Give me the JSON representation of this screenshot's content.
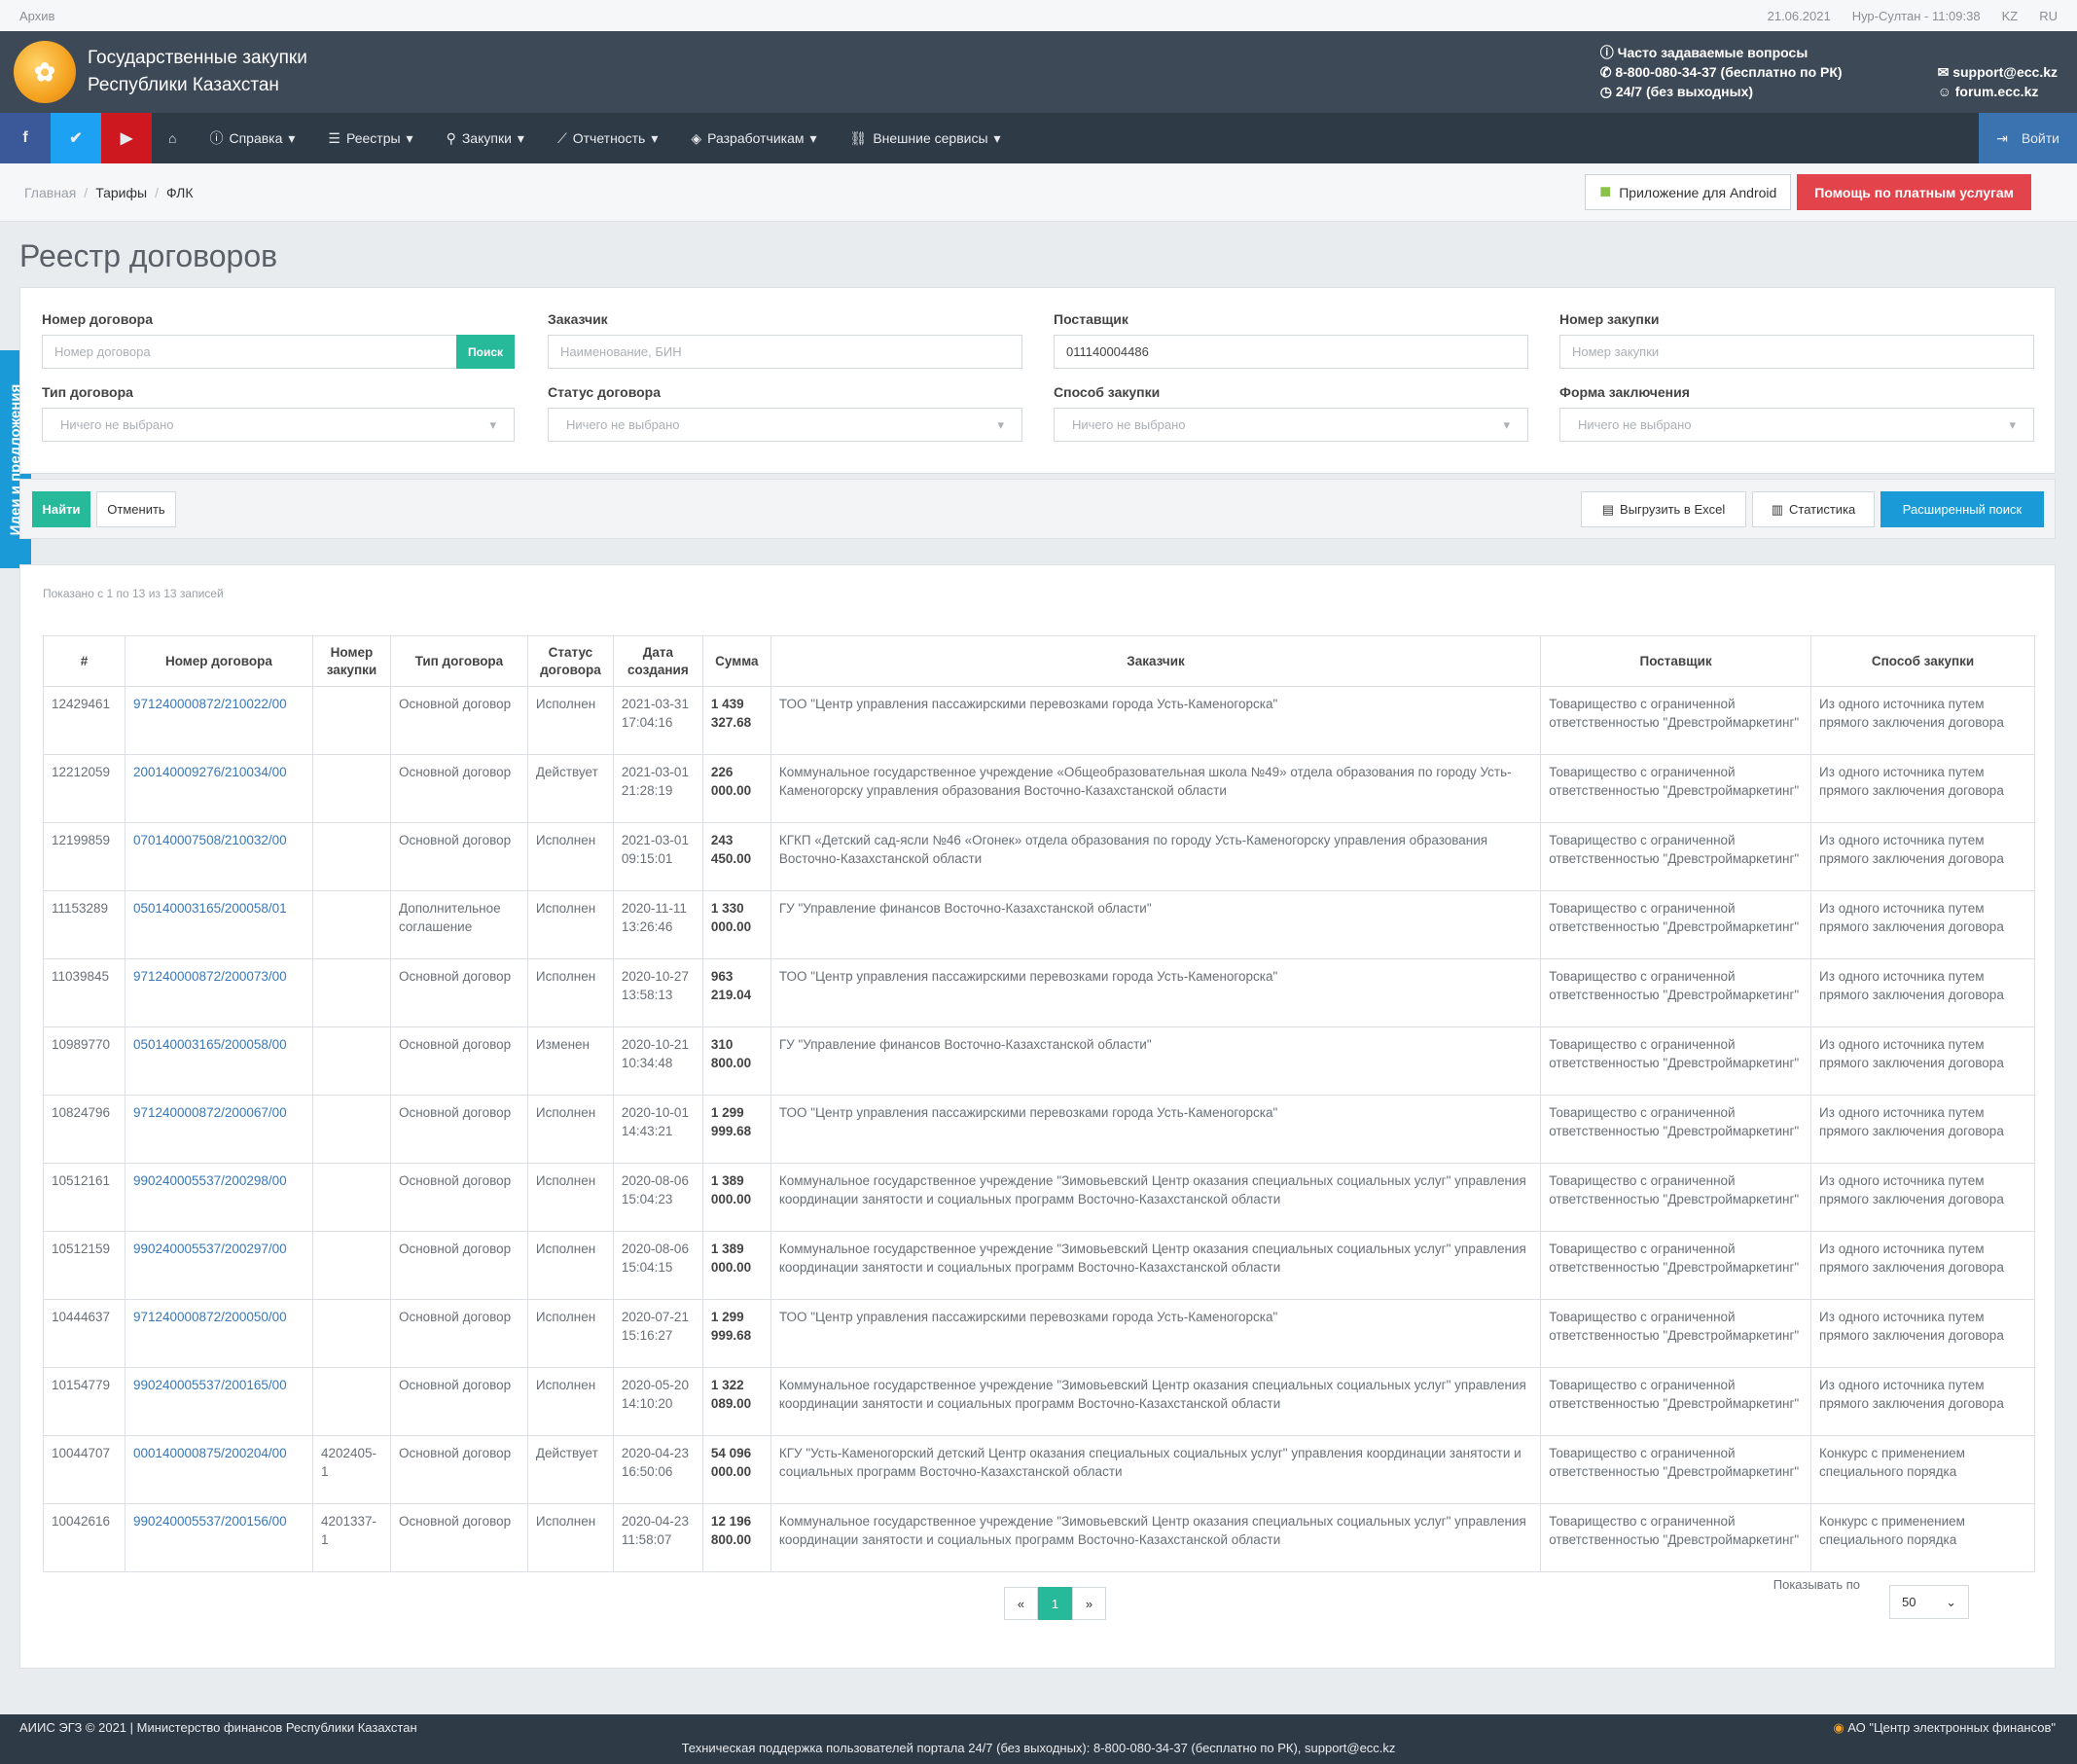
{
  "top_strip": {
    "archive": "Архив",
    "date": "21.06.2021",
    "time": "Нур-Султан - 11:09:38",
    "lang_kz": "KZ",
    "lang_ru": "RU"
  },
  "brand": {
    "line1": "Государственные закупки",
    "line2": "Республики Казахстан",
    "faq": "Часто задаваемые вопросы",
    "phone": "8-800-080-34-37 (бесплатно по РК)",
    "hours": "24/7 (без выходных)",
    "email": "support@ecc.kz",
    "forum": "forum.ecc.kz"
  },
  "nav": {
    "items": [
      "Справка",
      "Реестры",
      "Закупки",
      "Отчетность",
      "Разработчикам",
      "Внешние сервисы"
    ],
    "login": "Войти"
  },
  "breadcrumb": {
    "home": "Главная",
    "tariffs": "Тарифы",
    "current": "ФЛК"
  },
  "header_buttons": {
    "android": "Приложение для Android",
    "help": "Помощь по платным услугам"
  },
  "page_title": "Реестр договоров",
  "side_tab": "Идеи и предложения",
  "filters": {
    "contract_number": {
      "label": "Номер договора",
      "placeholder": "Номер договора",
      "button": "Поиск"
    },
    "customer": {
      "label": "Заказчик",
      "placeholder": "Наименование, БИН"
    },
    "supplier": {
      "label": "Поставщик",
      "value": "011140004486"
    },
    "purchase_number": {
      "label": "Номер закупки",
      "placeholder": "Номер закупки"
    },
    "contract_type": {
      "label": "Тип договора",
      "value": "Ничего не выбрано"
    },
    "contract_status": {
      "label": "Статус договора",
      "value": "Ничего не выбрано"
    },
    "purchase_method": {
      "label": "Способ закупки",
      "value": "Ничего не выбрано"
    },
    "form": {
      "label": "Форма заключения",
      "value": "Ничего не выбрано"
    }
  },
  "actions": {
    "find": "Найти",
    "cancel": "Отменить",
    "excel": "Выгрузить в Excel",
    "stats": "Статистика",
    "advanced": "Расширенный поиск"
  },
  "results_info": "Показано с 1 по 13 из 13 записей",
  "table": {
    "headers": [
      "#",
      "Номер договора",
      "Номер закупки",
      "Тип договора",
      "Статус договора",
      "Дата создания",
      "Сумма",
      "Заказчик",
      "Поставщик",
      "Способ закупки"
    ],
    "rows": [
      {
        "id": "12429461",
        "num": "971240000872/210022/00",
        "purchase": "",
        "type": "Основной договор",
        "status": "Исполнен",
        "date": "2021-03-31 17:04:16",
        "sum": "1 439 327.68",
        "customer": "ТОО \"Центр управления пассажирскими перевозками города Усть-Каменогорска\"",
        "supplier": "Товарищество с ограниченной ответственностью \"Древстроймаркетинг\"",
        "method": "Из одного источника путем прямого заключения договора"
      },
      {
        "id": "12212059",
        "num": "200140009276/210034/00",
        "purchase": "",
        "type": "Основной договор",
        "status": "Действует",
        "date": "2021-03-01 21:28:19",
        "sum": "226 000.00",
        "customer": "Коммунальное государственное учреждение «Общеобразовательная школа №49» отдела образования по городу Усть-Каменогорску управления образования Восточно-Казахстанской области",
        "supplier": "Товарищество с ограниченной ответственностью \"Древстроймаркетинг\"",
        "method": "Из одного источника путем прямого заключения договора"
      },
      {
        "id": "12199859",
        "num": "070140007508/210032/00",
        "purchase": "",
        "type": "Основной договор",
        "status": "Исполнен",
        "date": "2021-03-01 09:15:01",
        "sum": "243 450.00",
        "customer": "КГКП «Детский сад-ясли №46 «Огонек» отдела образования по городу Усть-Каменогорску управления образования Восточно-Казахстанской области",
        "supplier": "Товарищество с ограниченной ответственностью \"Древстроймаркетинг\"",
        "method": "Из одного источника путем прямого заключения договора"
      },
      {
        "id": "11153289",
        "num": "050140003165/200058/01",
        "purchase": "",
        "type": "Дополнительное соглашение",
        "status": "Исполнен",
        "date": "2020-11-11 13:26:46",
        "sum": "1 330 000.00",
        "customer": "ГУ \"Управление финансов Восточно-Казахстанской области\"",
        "supplier": "Товарищество с ограниченной ответственностью \"Древстроймаркетинг\"",
        "method": "Из одного источника путем прямого заключения договора"
      },
      {
        "id": "11039845",
        "num": "971240000872/200073/00",
        "purchase": "",
        "type": "Основной договор",
        "status": "Исполнен",
        "date": "2020-10-27 13:58:13",
        "sum": "963 219.04",
        "customer": "ТОО \"Центр управления пассажирскими перевозками города Усть-Каменогорска\"",
        "supplier": "Товарищество с ограниченной ответственностью \"Древстроймаркетинг\"",
        "method": "Из одного источника путем прямого заключения договора"
      },
      {
        "id": "10989770",
        "num": "050140003165/200058/00",
        "purchase": "",
        "type": "Основной договор",
        "status": "Изменен",
        "date": "2020-10-21 10:34:48",
        "sum": "310 800.00",
        "customer": "ГУ \"Управление финансов Восточно-Казахстанской области\"",
        "supplier": "Товарищество с ограниченной ответственностью \"Древстроймаркетинг\"",
        "method": "Из одного источника путем прямого заключения договора"
      },
      {
        "id": "10824796",
        "num": "971240000872/200067/00",
        "purchase": "",
        "type": "Основной договор",
        "status": "Исполнен",
        "date": "2020-10-01 14:43:21",
        "sum": "1 299 999.68",
        "customer": "ТОО \"Центр управления пассажирскими перевозками города Усть-Каменогорска\"",
        "supplier": "Товарищество с ограниченной ответственностью \"Древстроймаркетинг\"",
        "method": "Из одного источника путем прямого заключения договора"
      },
      {
        "id": "10512161",
        "num": "990240005537/200298/00",
        "purchase": "",
        "type": "Основной договор",
        "status": "Исполнен",
        "date": "2020-08-06 15:04:23",
        "sum": "1 389 000.00",
        "customer": "Коммунальное государственное учреждение \"Зимовьевский Центр оказания специальных социальных услуг\" управления координации занятости и социальных программ Восточно-Казахстанской области",
        "supplier": "Товарищество с ограниченной ответственностью \"Древстроймаркетинг\"",
        "method": "Из одного источника путем прямого заключения договора"
      },
      {
        "id": "10512159",
        "num": "990240005537/200297/00",
        "purchase": "",
        "type": "Основной договор",
        "status": "Исполнен",
        "date": "2020-08-06 15:04:15",
        "sum": "1 389 000.00",
        "customer": "Коммунальное государственное учреждение \"Зимовьевский Центр оказания специальных социальных услуг\" управления координации занятости и социальных программ Восточно-Казахстанской области",
        "supplier": "Товарищество с ограниченной ответственностью \"Древстроймаркетинг\"",
        "method": "Из одного источника путем прямого заключения договора"
      },
      {
        "id": "10444637",
        "num": "971240000872/200050/00",
        "purchase": "",
        "type": "Основной договор",
        "status": "Исполнен",
        "date": "2020-07-21 15:16:27",
        "sum": "1 299 999.68",
        "customer": "ТОО \"Центр управления пассажирскими перевозками города Усть-Каменогорска\"",
        "supplier": "Товарищество с ограниченной ответственностью \"Древстроймаркетинг\"",
        "method": "Из одного источника путем прямого заключения договора"
      },
      {
        "id": "10154779",
        "num": "990240005537/200165/00",
        "purchase": "",
        "type": "Основной договор",
        "status": "Исполнен",
        "date": "2020-05-20 14:10:20",
        "sum": "1 322 089.00",
        "customer": "Коммунальное государственное учреждение \"Зимовьевский Центр оказания специальных социальных услуг\" управления координации занятости и социальных программ Восточно-Казахстанской области",
        "supplier": "Товарищество с ограниченной ответственностью \"Древстроймаркетинг\"",
        "method": "Из одного источника путем прямого заключения договора"
      },
      {
        "id": "10044707",
        "num": "000140000875/200204/00",
        "purchase": "4202405-1",
        "type": "Основной договор",
        "status": "Действует",
        "date": "2020-04-23 16:50:06",
        "sum": "54 096 000.00",
        "customer": "КГУ \"Усть-Каменогорский детский Центр оказания специальных социальных услуг\" управления координации занятости и социальных программ Восточно-Казахстанской области",
        "supplier": "Товарищество с ограниченной ответственностью \"Древстроймаркетинг\"",
        "method": "Конкурс с применением специального порядка"
      },
      {
        "id": "10042616",
        "num": "990240005537/200156/00",
        "purchase": "4201337-1",
        "type": "Основной договор",
        "status": "Исполнен",
        "date": "2020-04-23 11:58:07",
        "sum": "12 196 800.00",
        "customer": "Коммунальное государственное учреждение \"Зимовьевский Центр оказания специальных социальных услуг\" управления координации занятости и социальных программ Восточно-Казахстанской области",
        "supplier": "Товарищество с ограниченной ответственностью \"Древстроймаркетинг\"",
        "method": "Конкурс с применением специального порядка"
      }
    ]
  },
  "pagination": {
    "prev": "«",
    "current": "1",
    "next": "»",
    "per_page_label": "Показывать по",
    "per_page": "50"
  },
  "footer": {
    "left": "АИИС ЭГЗ © 2021 | Министерство финансов Республики Казахстан",
    "right": "АО \"Центр электронных финансов\"",
    "center": "Техническая поддержка пользователей портала 24/7 (без выходных): 8-800-080-34-37 (бесплатно по РК), support@ecc.kz"
  },
  "colors": {
    "accent": "#26b99a",
    "brand_bar": "#3d4956",
    "nav": "#2f3a47",
    "danger": "#e3434b",
    "link": "#3a78b8"
  },
  "icons": {
    "facebook": "facebook-icon",
    "twitter": "twitter-icon",
    "youtube": "youtube-icon",
    "home": "home-icon"
  }
}
